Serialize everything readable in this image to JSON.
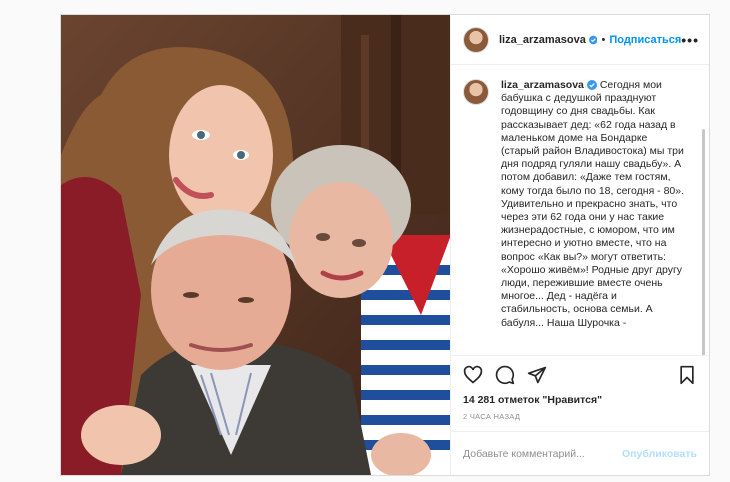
{
  "post": {
    "username": "liza_arzamasova",
    "follow_label": "Подписаться",
    "dot": "•",
    "more_label": "•••",
    "caption_username": "liza_arzamasova",
    "caption_text": "Сегодня мои бабушка с дедушкой празднуют годовщину со дня свадьбы. Как рассказывает дед: «62 года назад в маленьком доме на Бондарке (старый район Владивостока) мы три дня подряд гуляли нашу свадьбу». А потом добавил: «Даже тем гостям, кому тогда было по 18, сегодня - 80». Удивительно и прекрасно знать, что через эти 62 года они у нас такие жизнерадостные, с юмором, что им интересно и уютно вместе, что на вопрос «Как вы?» могут ответить: «Хорошо живём»! Родные друг другу люди, пережившие вместе очень многое... Дед - надёга и стабильность, основа семьи. А бабуля... Наша Шурочка -",
    "likes_count": "14 281 отметок",
    "likes_suffix": "\"Нравится\"",
    "time_ago": "2 часа назад",
    "comment_placeholder": "Добавьте комментарий...",
    "publish_label": "Опубликовать"
  },
  "icons": {
    "like": "heart-icon",
    "comment": "comment-icon",
    "share": "share-icon",
    "save": "bookmark-icon",
    "verified": "verified-badge-icon"
  },
  "colors": {
    "accent": "#0095f6",
    "publish_disabled": "#b2dffc",
    "text": "#262626",
    "muted": "#8e8e8e"
  }
}
